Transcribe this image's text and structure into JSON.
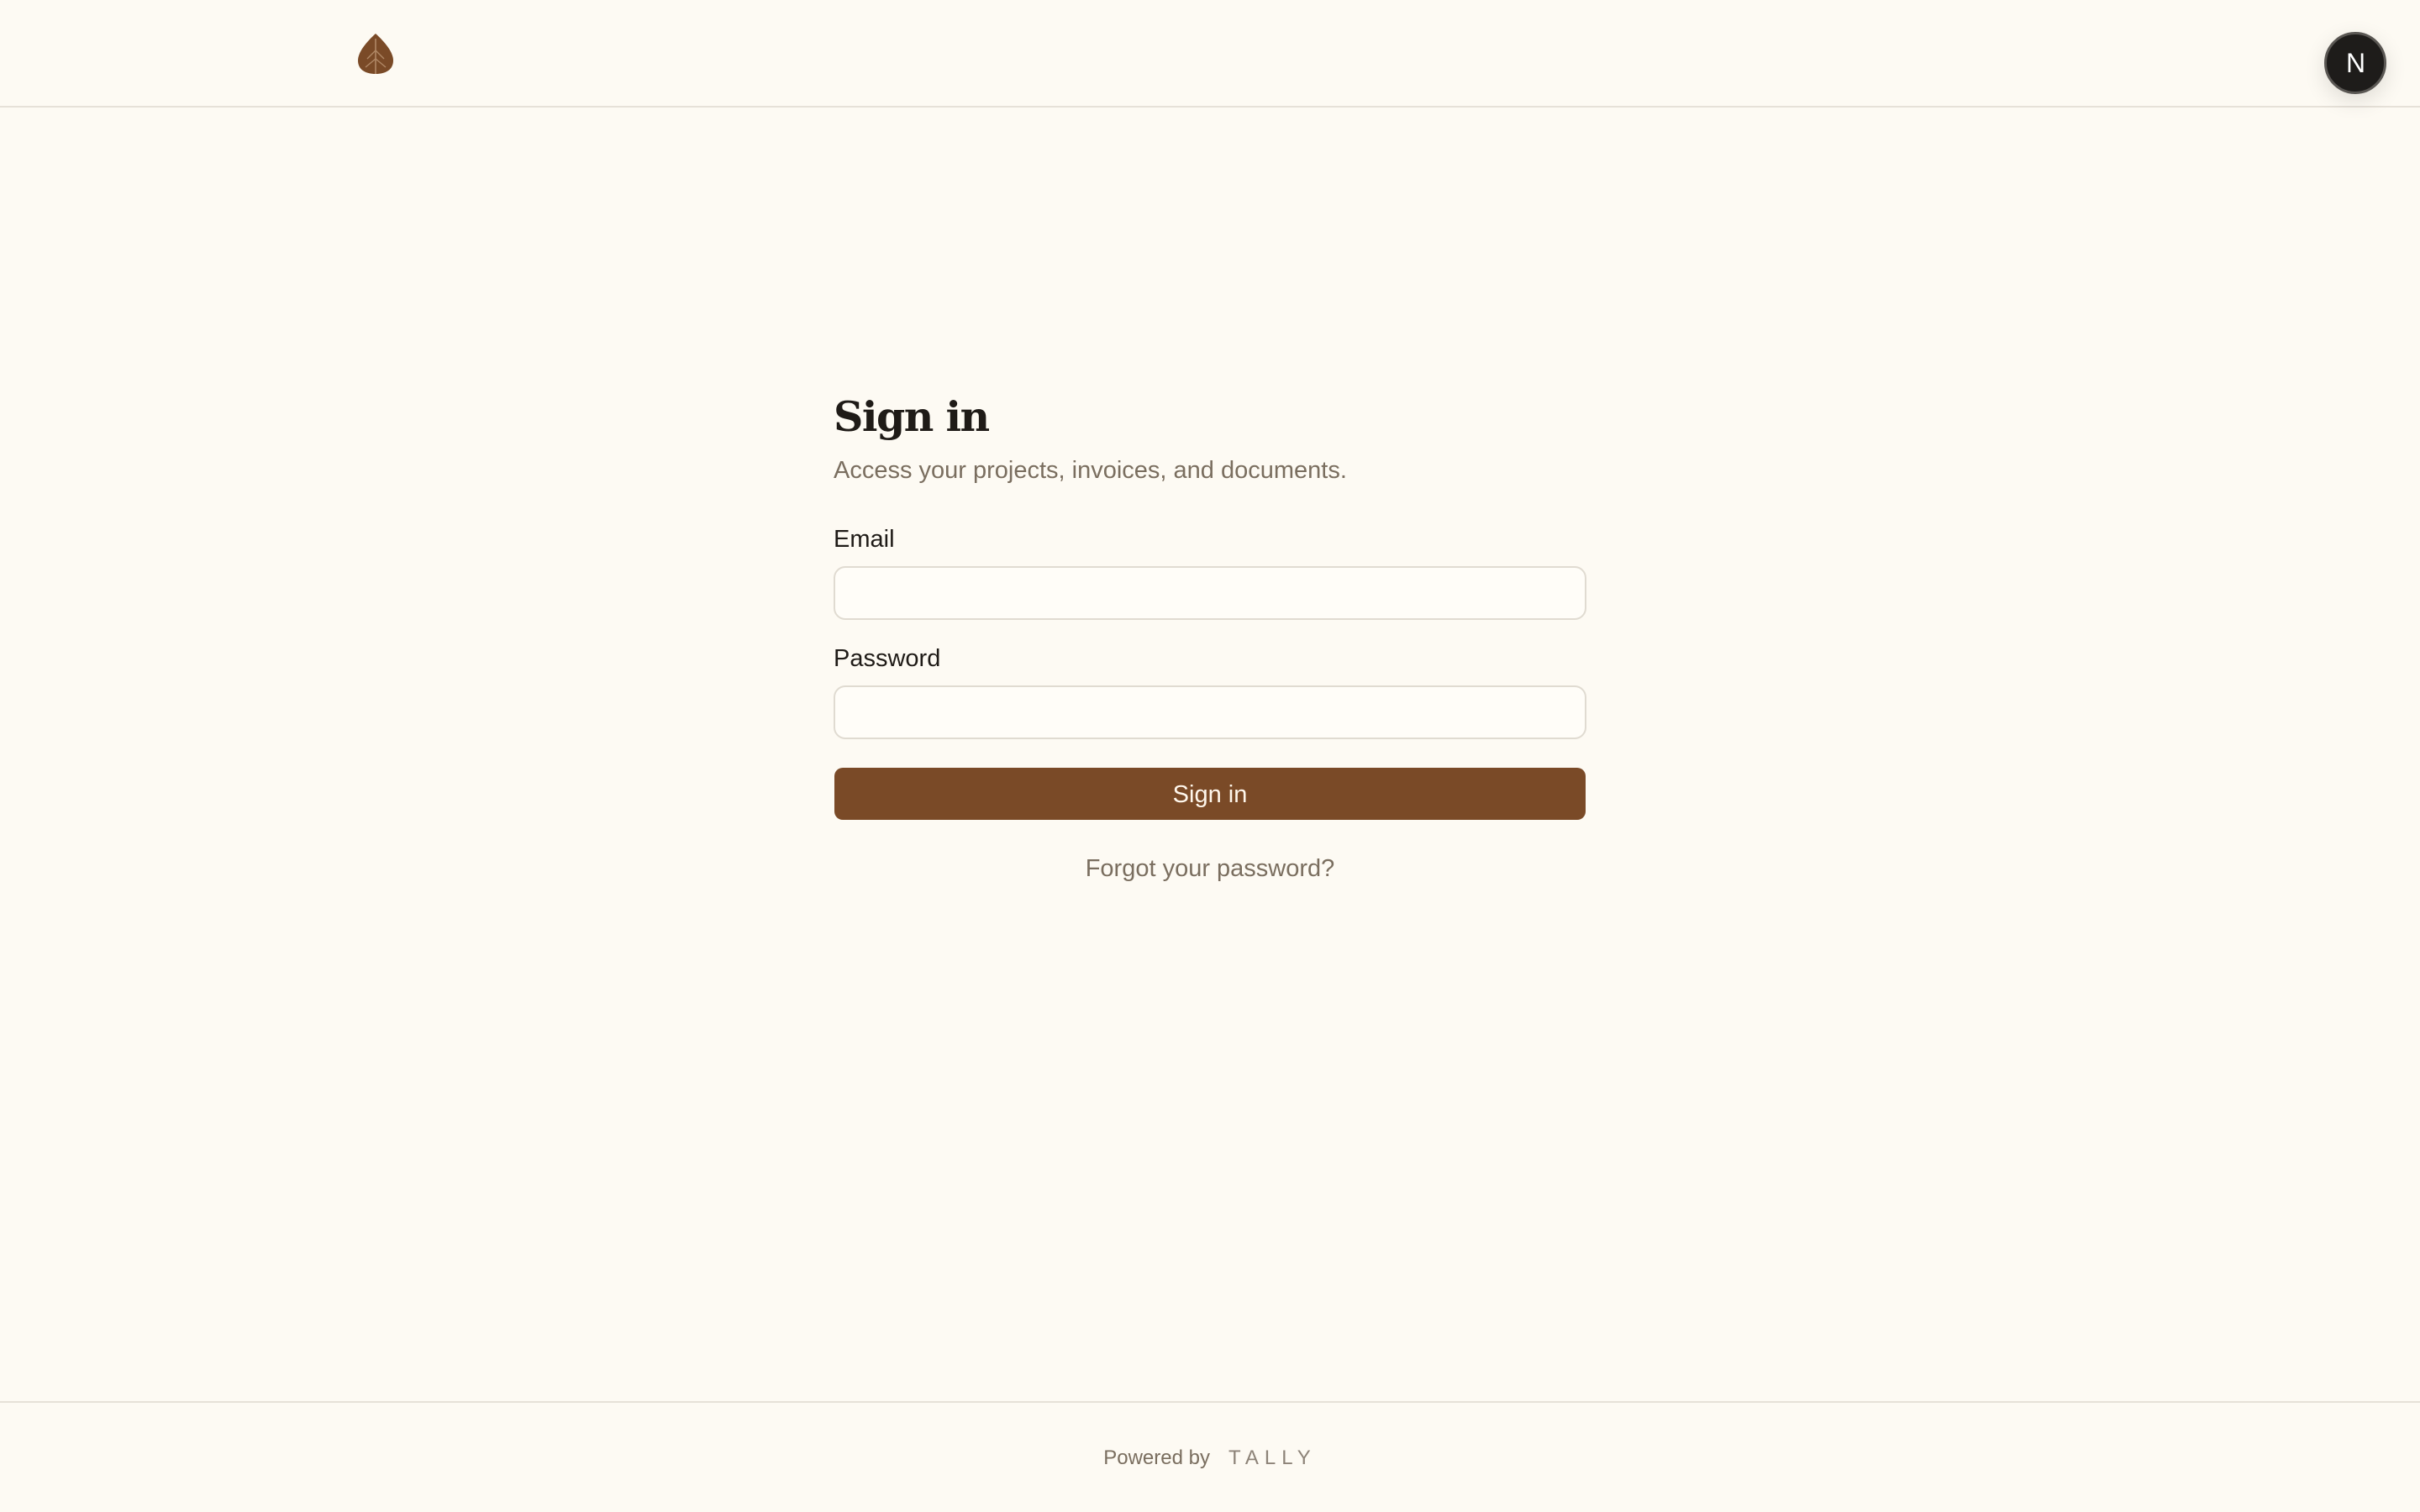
{
  "header": {
    "logo_icon": "leaf-icon",
    "avatar_initial": "N"
  },
  "signin": {
    "title": "Sign in",
    "subtitle": "Access your projects, invoices, and documents.",
    "email_label": "Email",
    "email_value": "",
    "password_label": "Password",
    "password_value": "",
    "submit_label": "Sign in",
    "forgot_label": "Forgot your password?"
  },
  "footer": {
    "powered_by": "Powered by",
    "brand": "TALLY"
  },
  "colors": {
    "background": "#fdfaf3",
    "accent": "#7a4a27",
    "muted_text": "#7a6e5f",
    "avatar_bg": "#1e1c1a"
  }
}
